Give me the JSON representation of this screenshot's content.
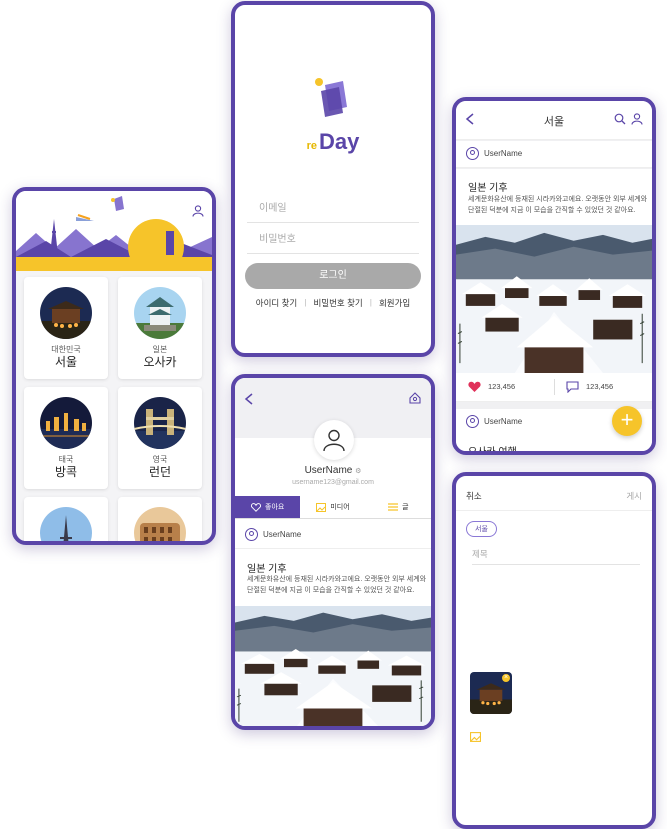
{
  "colors": {
    "brand": "#5a45a8",
    "accent": "#f6c42a",
    "heart": "#e0315a"
  },
  "app": {
    "logo_prefix": "re",
    "logo_name": "Day"
  },
  "city_screen": {
    "cities": [
      {
        "country": "대한민국",
        "name": "서울",
        "icon": "seoul-gate"
      },
      {
        "country": "일본",
        "name": "오사카",
        "icon": "osaka-castle"
      },
      {
        "country": "태국",
        "name": "방콕",
        "icon": "bangkok-night"
      },
      {
        "country": "영국",
        "name": "런던",
        "icon": "london-bridge"
      },
      {
        "country": "",
        "name": "",
        "icon": "paris-eiffel"
      },
      {
        "country": "",
        "name": "",
        "icon": "rome-colosseum"
      }
    ]
  },
  "login_screen": {
    "email_placeholder": "이메일",
    "password_placeholder": "비밀번호",
    "login_label": "로그인",
    "links": [
      "아이디 찾기",
      "비밀번호 찾기",
      "회원가입"
    ]
  },
  "feed_screen": {
    "title": "서울",
    "posts": [
      {
        "user": "UserName",
        "title": "일본 기후",
        "body_line1": "세계문화유산에 등재된 시라카와고에요. 오랫동안 외부 세계와",
        "body_line2": "단절된 덕분에 지금 이 모습을 간직할 수 있었던 것 같아요.",
        "likes": "123,456",
        "comments": "123,456"
      },
      {
        "user": "UserName",
        "title": "오사카 여행"
      }
    ],
    "fab_label": "+"
  },
  "profile_screen": {
    "username": "UserName",
    "email": "username123@gmail.com",
    "tabs": [
      "좋아요",
      "미디어",
      "글"
    ],
    "post": {
      "user": "UserName",
      "title": "일본 기후",
      "body_line1": "세계문화유산에 등재된 시라카와고에요. 오랫동안 외부 세계와",
      "body_line2": "단절된 덕분에 지금 이 모습을 간직할 수 있었던 것 같아요."
    }
  },
  "write_screen": {
    "cancel_label": "취소",
    "submit_label": "게시",
    "city_tag": "서울",
    "title_placeholder": "제목"
  }
}
